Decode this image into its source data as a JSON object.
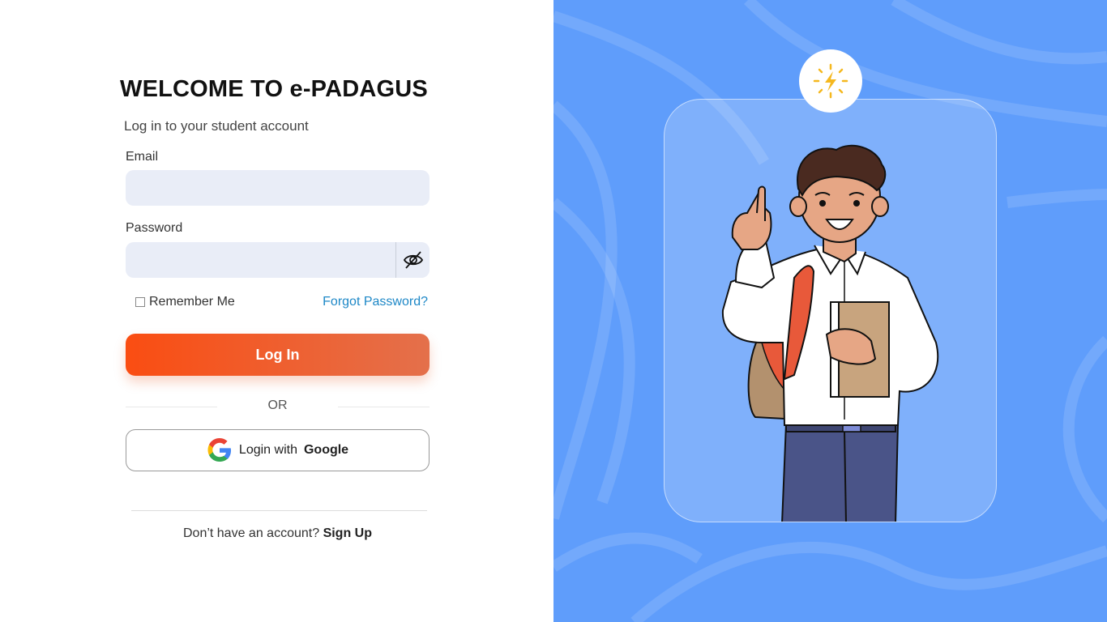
{
  "login": {
    "title": "WELCOME TO e-PADAGUS",
    "subtitle": "Log in to your student account",
    "email_label": "Email",
    "email_value": "",
    "password_label": "Password",
    "password_value": "",
    "remember_label": "Remember Me",
    "forgot_label": "Forgot Password?",
    "login_button": "Log In",
    "or_text": "OR",
    "google_prefix": "Login with",
    "google_brand": "Google",
    "signup_prompt": "Don’t have an account?",
    "signup_link": "Sign Up"
  },
  "icons": {
    "password_toggle": "eye-off-icon",
    "google": "google-logo-icon",
    "badge": "lightning-icon"
  },
  "colors": {
    "accent_gradient_start": "#fa4d12",
    "accent_gradient_end": "#e4704b",
    "right_panel": "#5f9dfb",
    "input_bg": "#e9edf7",
    "link": "#1e88c7"
  }
}
